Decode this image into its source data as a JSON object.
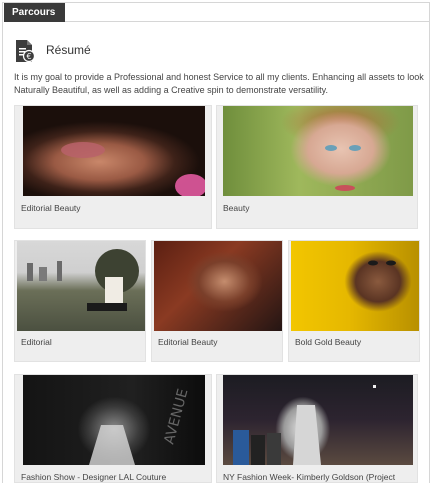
{
  "tab": {
    "label": "Parcours"
  },
  "section": {
    "icon": "resume-document-icon",
    "title": "Résumé",
    "intro": "It is my goal to provide a Professional and honest Service to all my clients. Enhancing all assets to look Naturally Beautiful, as well as adding a Creative spin to demonstrate versatility."
  },
  "portfolio": [
    {
      "caption": "Editorial Beauty"
    },
    {
      "caption": "Beauty"
    },
    {
      "caption": "Editorial"
    },
    {
      "caption": "Editorial Beauty"
    },
    {
      "caption": "Bold Gold Beauty"
    },
    {
      "caption": "Fashion Show - Designer LAL Couture"
    },
    {
      "caption": "NY Fashion Week- Kimberly Goldson (Project"
    }
  ]
}
